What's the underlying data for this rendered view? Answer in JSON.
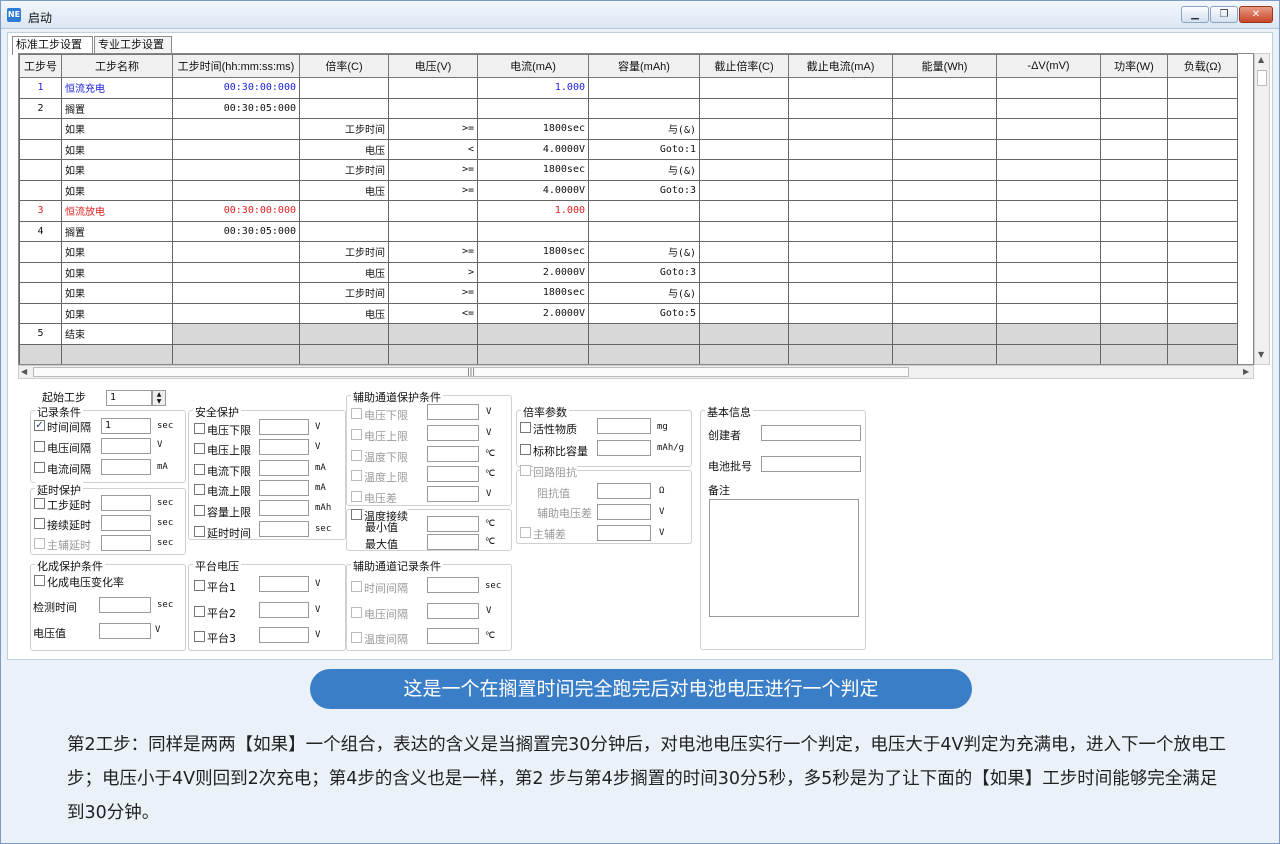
{
  "window": {
    "title": "启动",
    "icon": "app-icon",
    "buttons": [
      "minimize-icon",
      "restore-icon",
      "close-icon"
    ]
  },
  "tabs": [
    {
      "label": "标准工步设置",
      "active": true
    },
    {
      "label": "专业工步设置",
      "active": false
    }
  ],
  "grid": {
    "columns": [
      "工步号",
      "工步名称",
      "工步时间(hh:mm:ss:ms)",
      "倍率(C)",
      "电压(V)",
      "电流(mA)",
      "容量(mAh)",
      "截止倍率(C)",
      "截止电流(mA)",
      "能量(Wh)",
      "-ΔV(mV)",
      "功率(W)",
      "负载(Ω)"
    ],
    "rows": [
      {
        "style": "blue",
        "cells": [
          "1",
          "恒流充电",
          "00:30:00:000",
          "",
          "",
          "1.000",
          "",
          "",
          "",
          "",
          "",
          "",
          ""
        ]
      },
      {
        "style": "",
        "cells": [
          "2",
          "搁置",
          "00:30:05:000",
          "",
          "",
          "",
          "",
          "",
          "",
          "",
          "",
          "",
          ""
        ]
      },
      {
        "style": "",
        "cells": [
          "",
          "如果",
          "",
          "工步时间",
          ">=",
          "1800sec",
          "与(&)",
          "",
          "",
          "",
          "",
          "",
          ""
        ]
      },
      {
        "style": "",
        "cells": [
          "",
          "如果",
          "",
          "电压",
          "<",
          "4.0000V",
          "Goto:1",
          "",
          "",
          "",
          "",
          "",
          ""
        ]
      },
      {
        "style": "",
        "cells": [
          "",
          "如果",
          "",
          "工步时间",
          ">=",
          "1800sec",
          "与(&)",
          "",
          "",
          "",
          "",
          "",
          ""
        ]
      },
      {
        "style": "",
        "cells": [
          "",
          "如果",
          "",
          "电压",
          ">=",
          "4.0000V",
          "Goto:3",
          "",
          "",
          "",
          "",
          "",
          ""
        ]
      },
      {
        "style": "red",
        "cells": [
          "3",
          "恒流放电",
          "00:30:00:000",
          "",
          "",
          "1.000",
          "",
          "",
          "",
          "",
          "",
          "",
          ""
        ]
      },
      {
        "style": "",
        "cells": [
          "4",
          "搁置",
          "00:30:05:000",
          "",
          "",
          "",
          "",
          "",
          "",
          "",
          "",
          "",
          ""
        ]
      },
      {
        "style": "",
        "cells": [
          "",
          "如果",
          "",
          "工步时间",
          ">=",
          "1800sec",
          "与(&)",
          "",
          "",
          "",
          "",
          "",
          ""
        ]
      },
      {
        "style": "",
        "cells": [
          "",
          "如果",
          "",
          "电压",
          ">",
          "2.0000V",
          "Goto:3",
          "",
          "",
          "",
          "",
          "",
          ""
        ]
      },
      {
        "style": "",
        "cells": [
          "",
          "如果",
          "",
          "工步时间",
          ">=",
          "1800sec",
          "与(&)",
          "",
          "",
          "",
          "",
          "",
          ""
        ]
      },
      {
        "style": "",
        "cells": [
          "",
          "如果",
          "",
          "电压",
          "<=",
          "2.0000V",
          "Goto:5",
          "",
          "",
          "",
          "",
          "",
          ""
        ]
      },
      {
        "style": "end",
        "cells": [
          "5",
          "结束",
          "",
          "",
          "",
          "",
          "",
          "",
          "",
          "",
          "",
          "",
          ""
        ]
      },
      {
        "style": "empty",
        "cells": [
          "",
          "",
          "",
          "",
          "",
          "",
          "",
          "",
          "",
          "",
          "",
          "",
          ""
        ]
      }
    ]
  },
  "form": {
    "start_step_label": "起始工步",
    "start_step_value": "1",
    "record": {
      "title": "记录条件",
      "time_interval": "时间间隔",
      "time_value": "1",
      "time_unit": "sec",
      "time_checked": true,
      "voltage_interval": "电压间隔",
      "voltage_unit": "V",
      "current_interval": "电流间隔",
      "current_unit": "mA"
    },
    "delay": {
      "title": "延时保护",
      "step_delay": "工步延时",
      "cont_delay": "接续延时",
      "aux_delay": "主辅延时",
      "unit": "sec"
    },
    "chem": {
      "title": "化成保护条件",
      "rate": "化成电压变化率",
      "detect_time": "检测时间",
      "detect_unit": "sec",
      "voltage": "电压值",
      "voltage_unit": "V"
    },
    "safety": {
      "title": "安全保护",
      "v_low": "电压下限",
      "v_high": "电压上限",
      "i_low": "电流下限",
      "i_high": "电流上限",
      "cap_high": "容量上限",
      "delay": "延时时间",
      "u_v": "V",
      "u_ma": "mA",
      "u_mah": "mAh",
      "u_sec": "sec"
    },
    "plateau": {
      "title": "平台电压",
      "p1": "平台1",
      "p2": "平台2",
      "p3": "平台3",
      "unit": "V"
    },
    "aux_protect": {
      "title": "辅助通道保护条件",
      "v_low": "电压下限",
      "v_high": "电压上限",
      "t_low": "温度下限",
      "t_high": "温度上限",
      "v_diff": "电压差",
      "u_v": "V",
      "u_c": "℃"
    },
    "temp_cont": {
      "label": "温度接续",
      "min": "最小值",
      "max": "最大值",
      "unit": "℃"
    },
    "aux_record": {
      "title": "辅助通道记录条件",
      "time": "时间间隔",
      "voltage": "电压间隔",
      "temp": "温度间隔",
      "u_sec": "sec",
      "u_v": "V",
      "u_c": "℃"
    },
    "rate_params": {
      "title": "倍率参数",
      "active": "活性物质",
      "active_unit": "mg",
      "nominal": "标称比容量",
      "nominal_unit": "mAh/g"
    },
    "loop": {
      "title": "回路阻抗",
      "resist": "阻抗值",
      "resist_unit": "Ω",
      "aux_v": "辅助电压差",
      "aux_v_unit": "V",
      "main_aux": "主辅差",
      "main_aux_unit": "V"
    },
    "info": {
      "title": "基本信息",
      "creator": "创建者",
      "batch": "电池批号",
      "remark": "备注"
    }
  },
  "banner": "这是一个在搁置时间完全跑完后对电池电压进行一个判定",
  "description": "第2工步：同样是两两【如果】一个组合，表达的含义是当搁置完30分钟后，对电池电压实行一个判定，电压大于4V判定为充满电，进入下一个放电工步；电压小于4V则回到2次充电；第4步的含义也是一样，第2 步与第4步搁置的时间30分5秒，多5秒是为了让下面的【如果】工步时间能够完全满足到30分钟。"
}
